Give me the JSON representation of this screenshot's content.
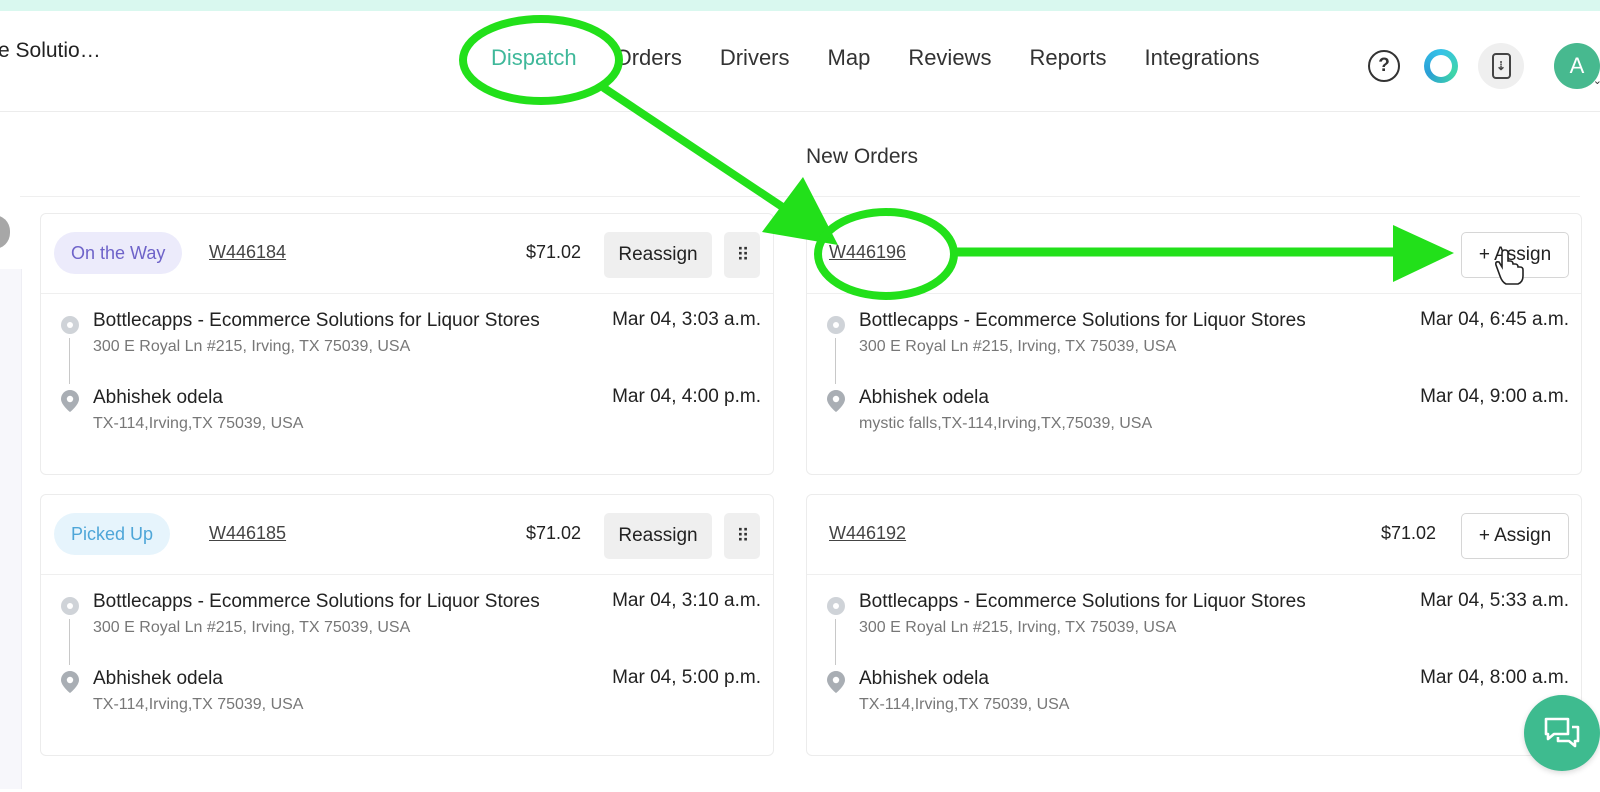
{
  "header": {
    "store_name": "e Solutio…",
    "nav": [
      "Dispatch",
      "Orders",
      "Drivers",
      "Map",
      "Reviews",
      "Reports",
      "Integrations"
    ],
    "active_nav": "Dispatch",
    "help_symbol": "?",
    "phone_icon": "mobile-download-icon",
    "avatar_initial": "A"
  },
  "main": {
    "section_title": "New Orders"
  },
  "in_progress_orders": [
    {
      "status": "On the Way",
      "order_id": "W446184",
      "price": "$71.02",
      "action": "Reassign",
      "pickup": {
        "name": "Bottlecapps - Ecommerce Solutions for Liquor Stores",
        "address": "300 E Royal Ln #215, Irving, TX 75039, USA",
        "time": "Mar 04, 3:03 a.m."
      },
      "dropoff": {
        "name": "Abhishek odela",
        "address": "TX-114,Irving,TX 75039, USA",
        "time": "Mar 04, 4:00 p.m."
      }
    },
    {
      "status": "Picked Up",
      "order_id": "W446185",
      "price": "$71.02",
      "action": "Reassign",
      "pickup": {
        "name": "Bottlecapps - Ecommerce Solutions for Liquor Stores",
        "address": "300 E Royal Ln #215, Irving, TX 75039, USA",
        "time": "Mar 04, 3:10 a.m."
      },
      "dropoff": {
        "name": "Abhishek odela",
        "address": "TX-114,Irving,TX 75039, USA",
        "time": "Mar 04, 5:00 p.m."
      }
    }
  ],
  "new_orders": [
    {
      "order_id": "W446196",
      "action": "+ Assign",
      "pickup": {
        "name": "Bottlecapps - Ecommerce Solutions for Liquor Stores",
        "address": "300 E Royal Ln #215, Irving, TX 75039, USA",
        "time": "Mar 04, 6:45 a.m."
      },
      "dropoff": {
        "name": "Abhishek odela",
        "address": "mystic falls,TX-114,Irving,TX,75039, USA",
        "time": "Mar 04, 9:00 a.m."
      }
    },
    {
      "order_id": "W446192",
      "price": "$71.02",
      "action": "+ Assign",
      "pickup": {
        "name": "Bottlecapps - Ecommerce Solutions for Liquor Stores",
        "address": "300 E Royal Ln #215, Irving, TX 75039, USA",
        "time": "Mar 04, 5:33 a.m."
      },
      "dropoff": {
        "name": "Abhishek odela",
        "address": "TX-114,Irving,TX 75039, USA",
        "time": "Mar 04, 8:00 a.m."
      }
    }
  ],
  "colors": {
    "accent": "#3fb89a",
    "annotation": "#22e01a",
    "on_the_way": "#6e63c9",
    "picked_up": "#4ea6d8",
    "chat_button": "#3ebb8f"
  }
}
